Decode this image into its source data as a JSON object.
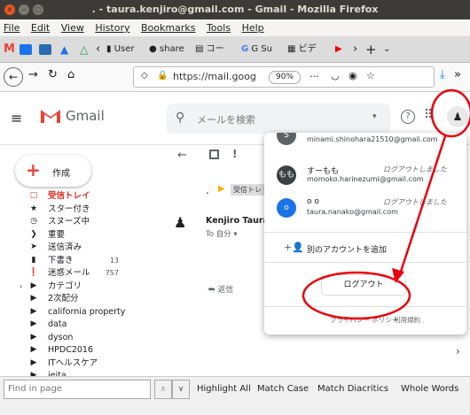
{
  "window": {
    "title": ". - taura.kenjiro@gmail.com - Gmail - Mozilla Firefox"
  },
  "menu": [
    "File",
    "Edit",
    "View",
    "History",
    "Bookmarks",
    "Tools",
    "Help"
  ],
  "tabs": [
    "User",
    "share",
    "コー",
    "G Su",
    "ビデ"
  ],
  "url": {
    "text": "https://mail.goog",
    "zoom": "90%"
  },
  "gmail": {
    "logo_text": "Gmail",
    "search_placeholder": "メールを検索"
  },
  "sidebar": {
    "compose": "作成",
    "items": [
      {
        "label": "受信トレイ",
        "icon": "inbox-icon",
        "count": "",
        "active": true
      },
      {
        "label": "スター付き",
        "icon": "star-icon",
        "count": ""
      },
      {
        "label": "スヌーズ中",
        "icon": "clock-icon",
        "count": ""
      },
      {
        "label": "重要",
        "icon": "important-icon",
        "count": ""
      },
      {
        "label": "送信済み",
        "icon": "send-icon",
        "count": ""
      },
      {
        "label": "下書き",
        "icon": "draft-icon",
        "count": "13"
      },
      {
        "label": "迷惑メール",
        "icon": "spam-icon",
        "count": "757"
      },
      {
        "label": "カテゴリ",
        "icon": "label-icon",
        "count": ""
      },
      {
        "label": "2次配分",
        "icon": "label-icon",
        "count": ""
      },
      {
        "label": "california property",
        "icon": "label-icon",
        "count": ""
      },
      {
        "label": "data",
        "icon": "label-icon",
        "count": ""
      },
      {
        "label": "dyson",
        "icon": "label-icon",
        "count": ""
      },
      {
        "label": "HPDC2016",
        "icon": "label-icon",
        "count": ""
      },
      {
        "label": "ITヘルスケア",
        "icon": "label-icon",
        "count": ""
      },
      {
        "label": "ieita",
        "icon": "label-icon",
        "count": ""
      }
    ]
  },
  "email": {
    "subject": ".",
    "label_chip": "受信トレ",
    "sender": "Kenjiro Taura",
    "to": "To 自分",
    "reply": "返信"
  },
  "accounts": [
    {
      "initial": "S",
      "name": "minami.shinohara",
      "email": "minami.shinohara21510@gmail.com",
      "status": "ログアウトしました",
      "color": "#5f6368"
    },
    {
      "initial": "もも",
      "name": "すーもも",
      "email": "momoko.harinezumi@gmail.com",
      "status": "ログアウトしました",
      "color": "#3c4043"
    },
    {
      "initial": "o",
      "name": "o o",
      "email": "taura.nanako@gmail.com",
      "status": "ログアウトしました",
      "color": "#1a73e8"
    }
  ],
  "account_menu": {
    "add": "別のアカウントを追加",
    "logout": "ログアウト",
    "privacy": "プライバシー ポリシー",
    "terms": "利用規約"
  },
  "findbar": {
    "placeholder": "Find in page",
    "options": [
      "Highlight All",
      "Match Case",
      "Match Diacritics",
      "Whole Words"
    ]
  },
  "colors": {
    "gmail_red": "#ea4335",
    "annotation_red": "#e8000b"
  }
}
